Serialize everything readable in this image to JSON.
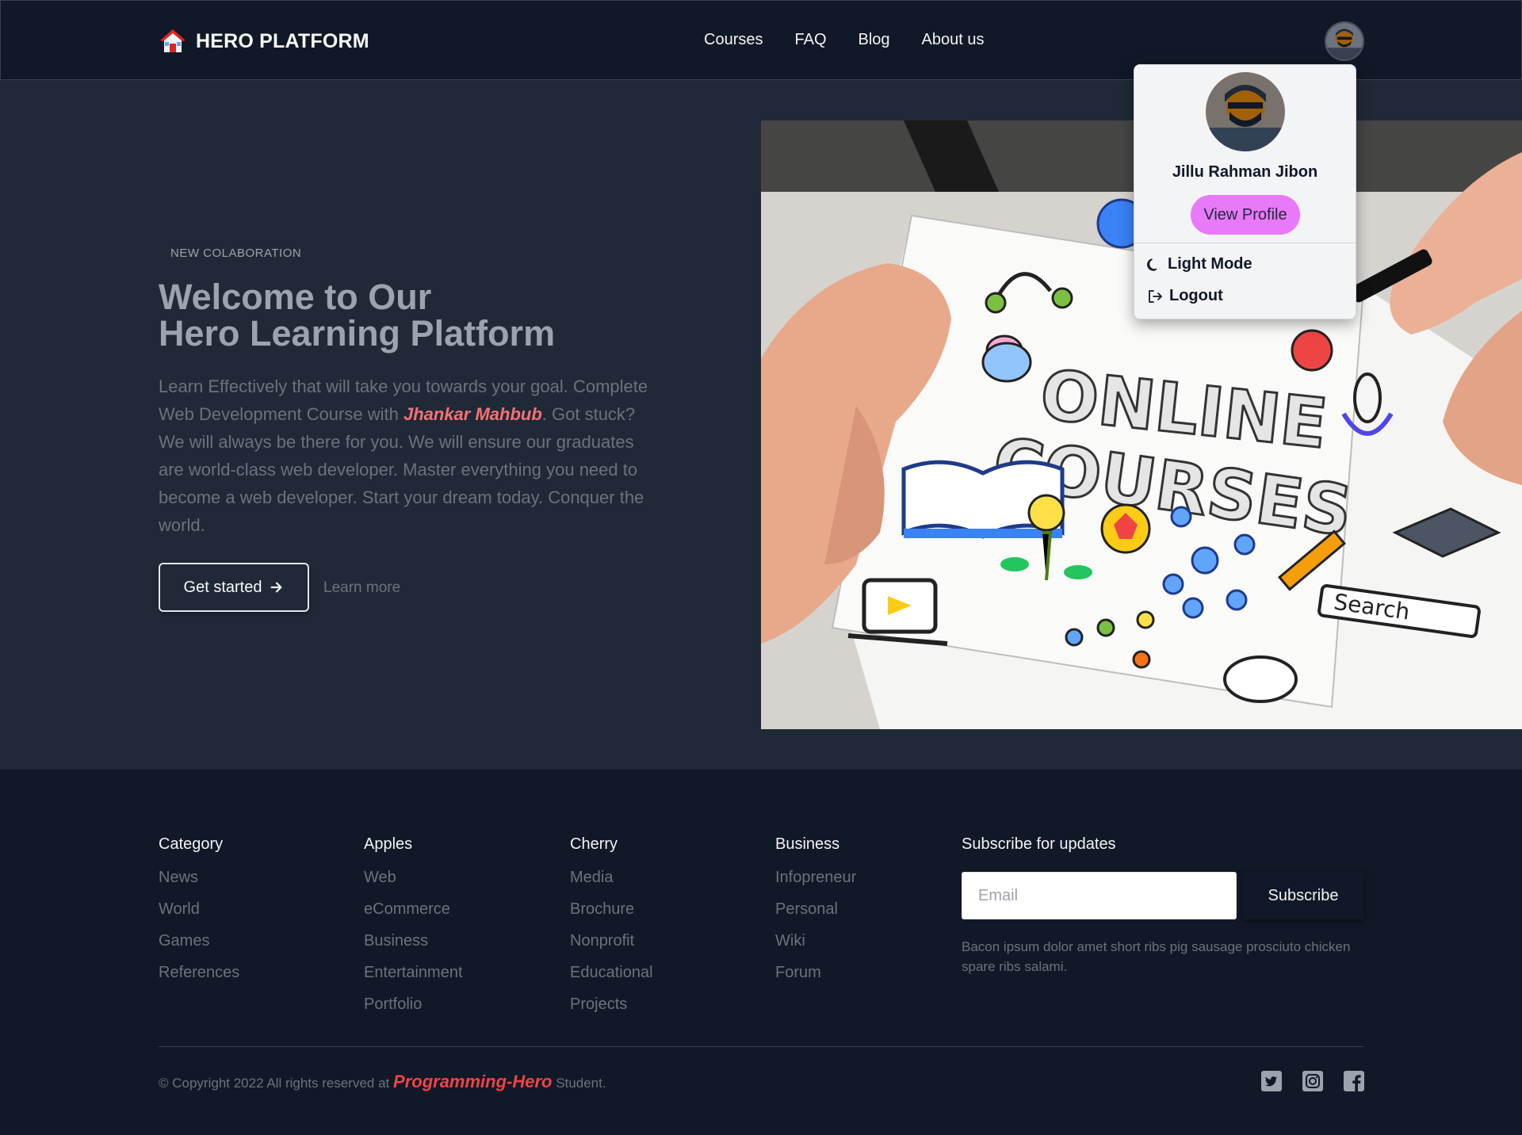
{
  "navbar": {
    "brand": "HERO PLATFORM",
    "links": [
      "Courses",
      "FAQ",
      "Blog",
      "About us"
    ]
  },
  "profile_menu": {
    "name": "Jillu Rahman Jibon",
    "view_profile": "View Profile",
    "theme_toggle": "Light Mode",
    "logout": "Logout"
  },
  "hero": {
    "tagline": "NEW COLABORATION",
    "title_line1": "Welcome to Our",
    "title_line2": "Hero Learning Platform",
    "desc_part1": "Learn Effectively that will take you towards your goal. Complete Web Development Course with ",
    "desc_highlight": "Jhankar Mahbub",
    "desc_part2": ". Got stuck? We will always be there for you. We will ensure our graduates are world-class web developer. Master everything you need to become a web developer. Start your dream today. Conquer the world.",
    "primary_button": "Get started",
    "secondary_button": "Learn more",
    "image_text_line1": "ONLINE",
    "image_text_line2": "COURSES",
    "image_search_label": "Search"
  },
  "footer": {
    "columns": [
      {
        "title": "Category",
        "links": [
          "News",
          "World",
          "Games",
          "References"
        ]
      },
      {
        "title": "Apples",
        "links": [
          "Web",
          "eCommerce",
          "Business",
          "Entertainment",
          "Portfolio"
        ]
      },
      {
        "title": "Cherry",
        "links": [
          "Media",
          "Brochure",
          "Nonprofit",
          "Educational",
          "Projects"
        ]
      },
      {
        "title": "Business",
        "links": [
          "Infopreneur",
          "Personal",
          "Wiki",
          "Forum"
        ]
      }
    ],
    "subscribe_title": "Subscribe for updates",
    "email_placeholder": "Email",
    "subscribe_button": "Subscribe",
    "subscribe_note": "Bacon ipsum dolor amet short ribs pig sausage prosciuto chicken spare ribs salami.",
    "copyright_prefix": "© Copyright 2022 All rights reserved at ",
    "copyright_brand": "Programming-Hero",
    "copyright_suffix": " Student.",
    "social_icons": [
      "twitter-icon",
      "instagram-icon",
      "facebook-icon"
    ]
  },
  "colors": {
    "nav_bg": "#111827",
    "hero_bg": "#1f2937",
    "accent_pink": "#e879f9",
    "accent_red": "#ef4444"
  }
}
